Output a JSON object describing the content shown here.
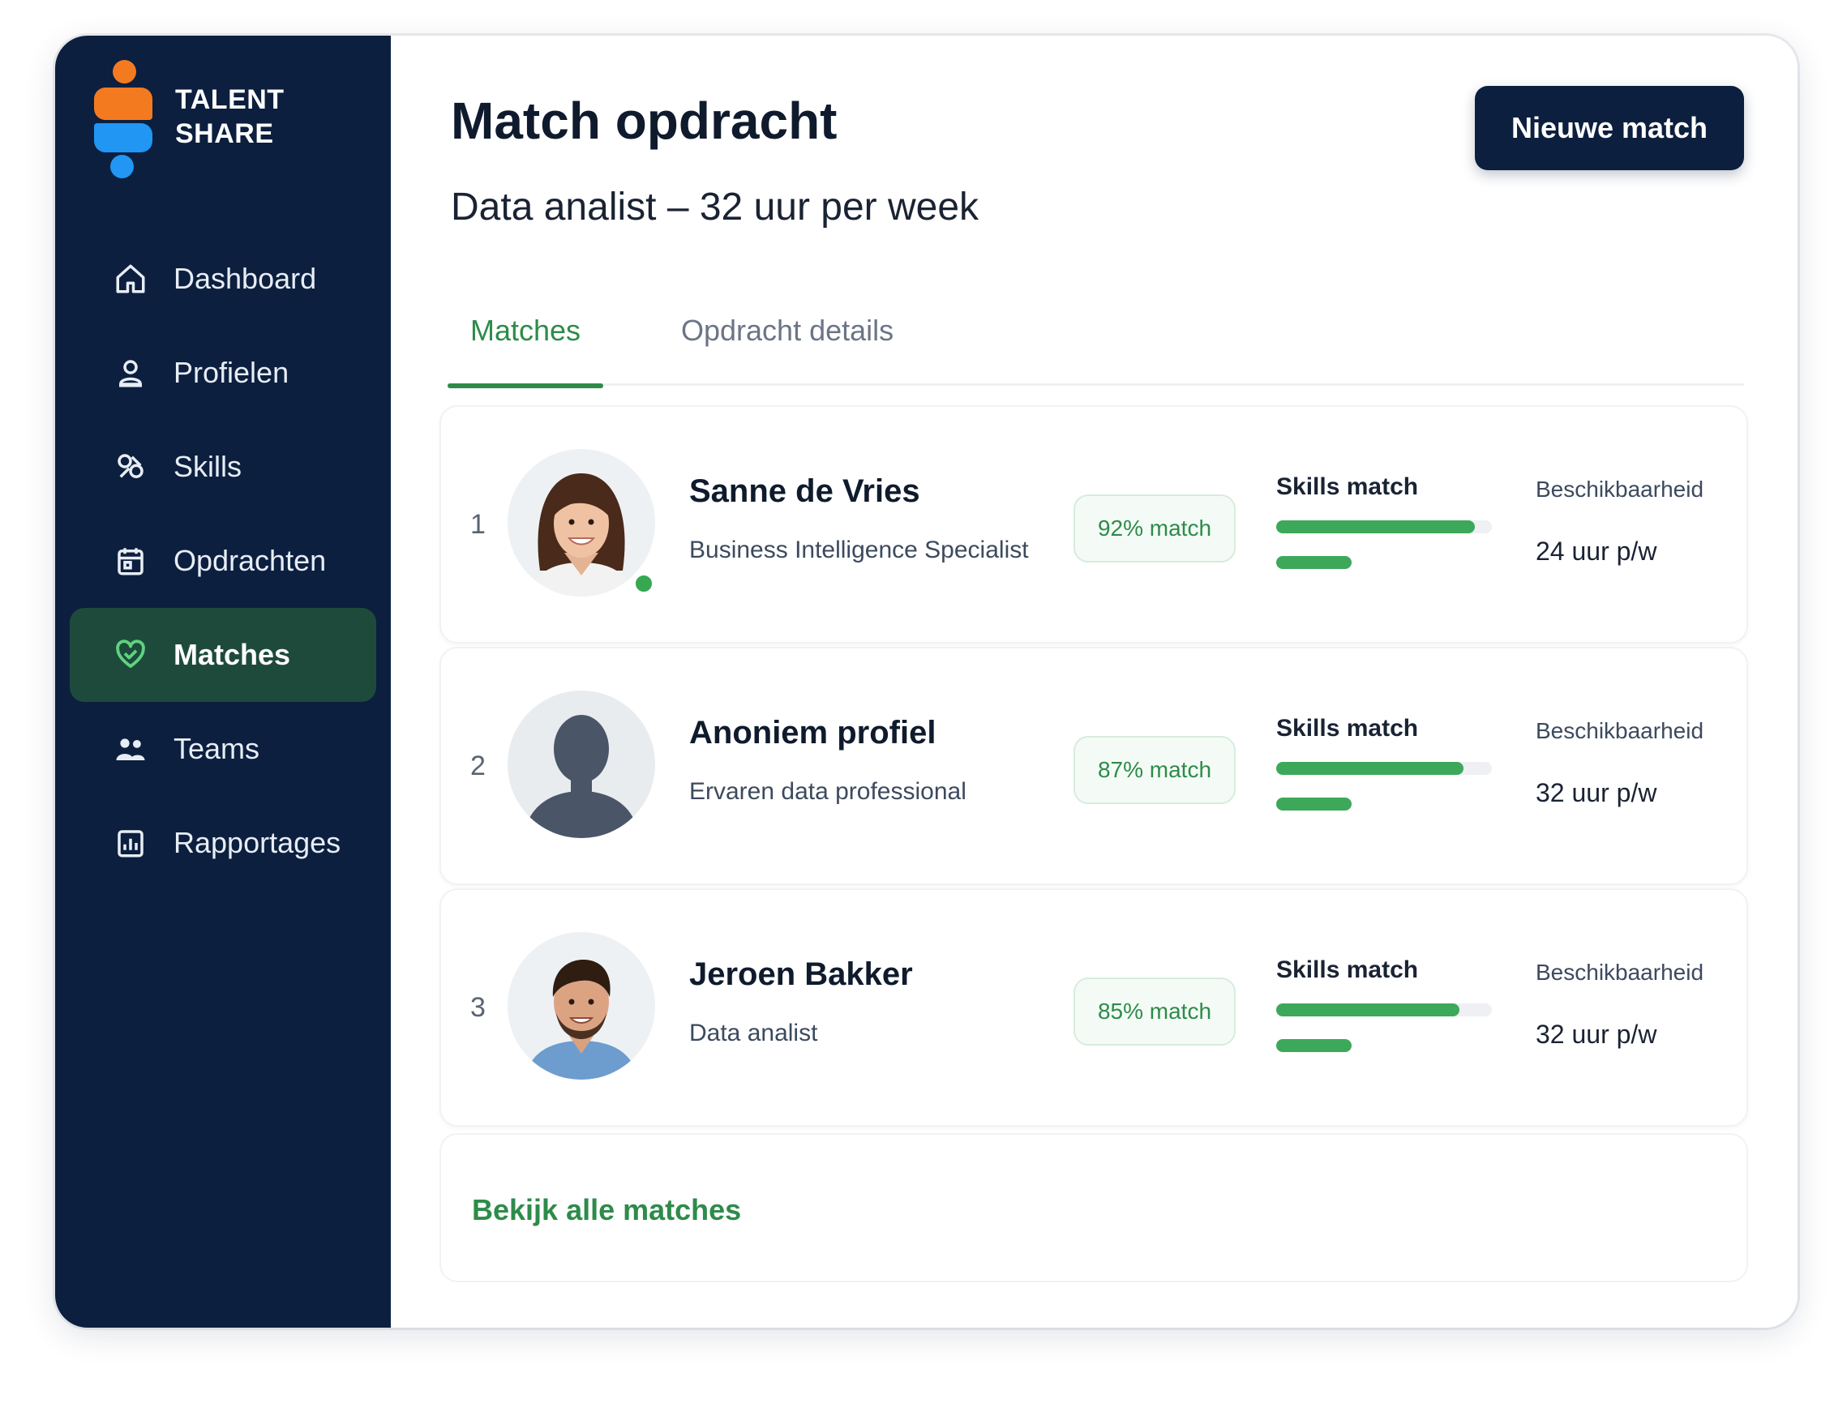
{
  "brand": {
    "line1": "TALENT",
    "line2": "SHARE"
  },
  "sidebar": {
    "items": [
      {
        "label": "Dashboard",
        "icon": "home-icon"
      },
      {
        "label": "Profielen",
        "icon": "profile-icon"
      },
      {
        "label": "Skills",
        "icon": "skills-icon"
      },
      {
        "label": "Opdrachten",
        "icon": "assignments-icon"
      },
      {
        "label": "Matches",
        "icon": "matches-icon",
        "active": true
      },
      {
        "label": "Teams",
        "icon": "teams-icon"
      },
      {
        "label": "Rapportages",
        "icon": "reports-icon"
      }
    ]
  },
  "header": {
    "title": "Match opdracht",
    "subtitle": "Data analist – 32 uur per week",
    "new_match_label": "Nieuwe match"
  },
  "tabs": [
    {
      "label": "Matches",
      "active": true
    },
    {
      "label": "Opdracht details",
      "active": false
    }
  ],
  "matches": [
    {
      "rank": "1",
      "name": "Sanne de Vries",
      "role": "Business Intelligence Specialist",
      "match": "92% match",
      "skills_label": "Skills match",
      "skills_fraction": 0.92,
      "availability_label": "Beschikbaarheid",
      "availability": "24 uur p/w",
      "avatar": "female-portrait",
      "online": true
    },
    {
      "rank": "2",
      "name": "Anoniem profiel",
      "role": "Ervaren data professional",
      "match": "87% match",
      "skills_label": "Skills match",
      "skills_fraction": 0.87,
      "availability_label": "Beschikbaarheid",
      "availability": "32 uur p/w",
      "avatar": "anonymous-silhouette",
      "online": false
    },
    {
      "rank": "3",
      "name": "Jeroen Bakker",
      "role": "Data analist",
      "match": "85% match",
      "skills_label": "Skills match",
      "skills_fraction": 0.85,
      "availability_label": "Beschikbaarheid",
      "availability": "32 uur p/w",
      "avatar": "male-portrait",
      "online": false
    }
  ],
  "footer": {
    "view_all_label": "Bekijk alle matches"
  },
  "colors": {
    "sidebar_bg": "#0c1f3f",
    "accent_green": "#2e8b4a",
    "brand_orange": "#f47a20",
    "brand_blue": "#2196f3"
  }
}
